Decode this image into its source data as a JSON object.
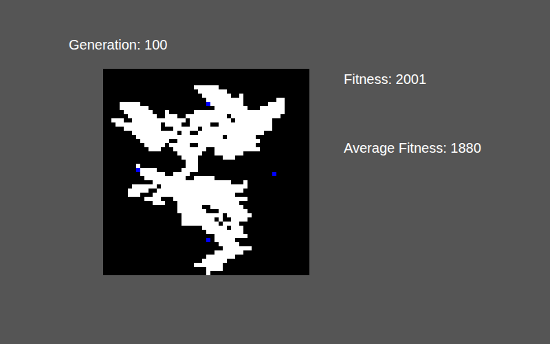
{
  "generation": {
    "label": "Generation: 100"
  },
  "stats": {
    "fitness": "Fitness: 2001",
    "average_fitness": "Average Fitness: 1880"
  },
  "grid": {
    "rows": [
      "00000000000000000000000000000000000000000000000000",
      "00000000000000000000000000000000000000000000000000",
      "00000000000000000000000000000000000000000000000000",
      "00000000000000000000000000000000000000000000000000",
      "00000000000000000000001111110000000000000000000000",
      "00000000000000000000000111111100000000000000000000",
      "00000000000000000000000011111110010000000000000000",
      "00000000000000000000000001111111110000000011000000",
      "00001111100000000000000002111111110000001111000000",
      "00001111111000000000000000011111111000111111000000",
      "00000111111100010000001111111111111111111111000000",
      "00000011111110011100111111111101111111111110000000",
      "00111001111111111111011111111110111111111000000000",
      "00011111111111011110011111001111111111111000000000",
      "00000111111111000111111011111111111111111000000000",
      "00000001111111111101100111111111111111100000000000",
      "00000000111111111111111111111011111110000000000000",
      "00000000011111110011111111111111111111000000000000",
      "00000000001111101111100111111111111110000000000000",
      "00000000000111000111111110011111111111000000000000",
      "00000000000000000011111100011111110000000000000000",
      "00000000000000000001111000000111000000000000000000",
      "00000000000000000000111000000000000000000000000000",
      "00000000100000000000111000000000000000000000000000",
      "00000000211110000001111000000000000000000000000000",
      "00000000011111100111100000000000000000000200000000",
      "00000000001111111111001111100000000000000000000000",
      "00000000000011111111111111111110001000000000000000",
      "00000001111110111111111111111111111000000000000000",
      "00000011111001111111111111111111110000000000000000",
      "00000011100011111111111111111111000000000000000000",
      "00000000001111000111111111111111111000000000000000",
      "00000000000011100011111111111111100000000000000000",
      "00000000000000000011111100111111110000000000000000",
      "00000000000000000011111110001111111000000000000000",
      "00000000000000000001111111111011111100000000000000",
      "00000000000000000001111111101001111000000000000000",
      "00000000000000000001111111110111100000000000000000",
      "00000000000000000000000011111101110000000000000000",
      "00000000000000000000000001111111110000000000000000",
      "00000000000000000000000000011111111000000000000000",
      "00000000000000000000000002011111000000000000000000",
      "00000000000000000000000000001111100000000000000000",
      "00000000000000000000000000000111111100000000000000",
      "00000000000000000000000000011111110000000000000000",
      "00000000000000000000000001111111000000000000000000",
      "00000000000000000000000011111100000000000000000000",
      "00000000000000000000001111111000000000000000000000",
      "00000000000000000000000001111000000000000000000000",
      "00000000000000000000000001000000000000000000000000"
    ]
  }
}
